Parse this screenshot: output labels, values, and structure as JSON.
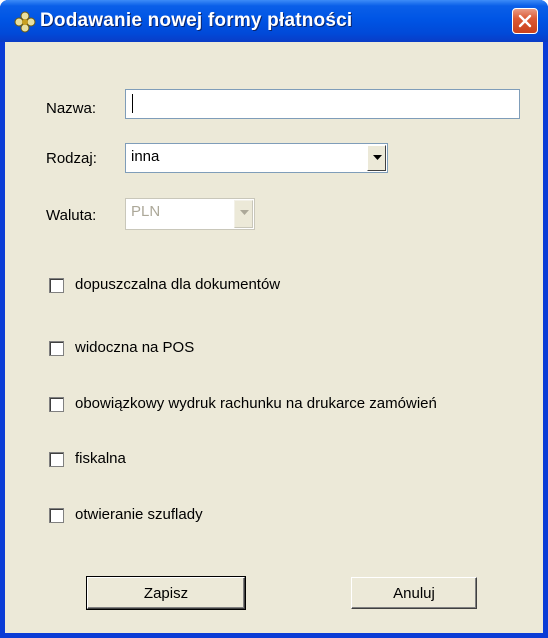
{
  "window": {
    "title": "Dodawanie nowej formy płatności",
    "title_color": "#0055e5",
    "close_icon": "close-icon"
  },
  "form": {
    "nazwa": {
      "label": "Nazwa:",
      "value": ""
    },
    "rodzaj": {
      "label": "Rodzaj:",
      "value": "inna"
    },
    "waluta": {
      "label": "Waluta:",
      "value": "PLN",
      "disabled": true
    }
  },
  "checkboxes": [
    {
      "label": "dopuszczalna dla dokumentów",
      "checked": false
    },
    {
      "label": "widoczna na POS",
      "checked": false
    },
    {
      "label": "obowiązkowy wydruk rachunku na drukarce zamówień",
      "checked": false
    },
    {
      "label": "fiskalna",
      "checked": false
    },
    {
      "label": "otwieranie szuflady",
      "checked": false
    }
  ],
  "buttons": {
    "save_label": "Zapisz",
    "cancel_label": "Anuluj"
  }
}
